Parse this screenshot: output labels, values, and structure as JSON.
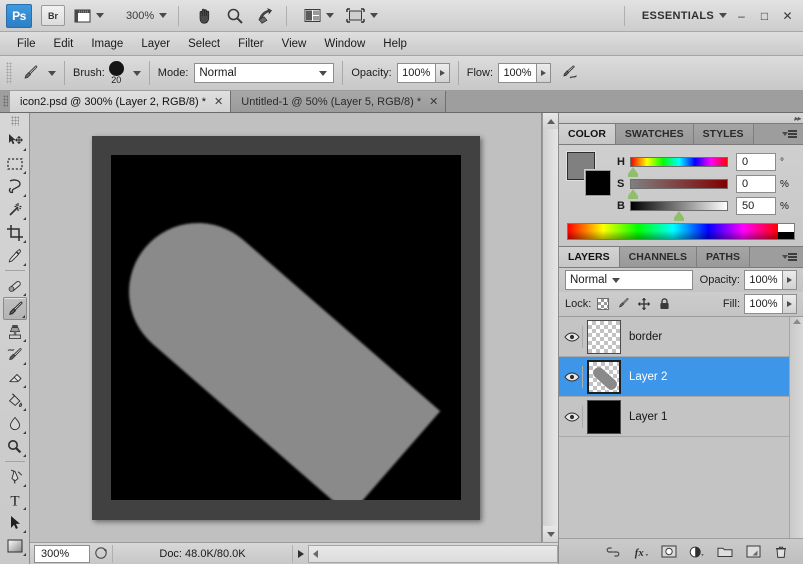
{
  "appbar": {
    "logo": "Ps",
    "bridge_label": "Br",
    "view_extras_icon": "view-extras-icon",
    "zoom_level": "300%",
    "hand_icon": "hand-tool-icon",
    "zoom_icon": "zoom-tool-icon",
    "rotate_icon": "rotate-view-icon",
    "arrange_icon": "arrange-documents-icon",
    "screen_mode_icon": "screen-mode-icon",
    "workspace": "ESSENTIALS",
    "minimize": "–",
    "maximize": "□",
    "close": "✕"
  },
  "menubar": {
    "items": [
      {
        "label": "File"
      },
      {
        "label": "Edit"
      },
      {
        "label": "Image"
      },
      {
        "label": "Layer"
      },
      {
        "label": "Select"
      },
      {
        "label": "Filter"
      },
      {
        "label": "View"
      },
      {
        "label": "Window"
      },
      {
        "label": "Help"
      }
    ]
  },
  "options_bar": {
    "tool_icon": "brush-tool-icon",
    "brush_label": "Brush:",
    "brush_size": "20",
    "mode_label": "Mode:",
    "mode_value": "Normal",
    "opacity_label": "Opacity:",
    "opacity_value": "100%",
    "flow_label": "Flow:",
    "flow_value": "100%",
    "airbrush_icon": "airbrush-icon"
  },
  "tabs": [
    {
      "title": "icon2.psd @ 300% (Layer 2, RGB/8) *",
      "close": "✕",
      "active": true
    },
    {
      "title": "Untitled-1 @ 50% (Layer 5, RGB/8) *",
      "close": "✕",
      "active": false
    }
  ],
  "toolbox": {
    "tools": [
      {
        "name": "move-tool",
        "active": false
      },
      {
        "name": "rectangular-marquee-tool",
        "active": false
      },
      {
        "name": "lasso-tool",
        "active": false
      },
      {
        "name": "magic-wand-tool",
        "active": false
      },
      {
        "name": "crop-tool",
        "active": false
      },
      {
        "name": "eyedropper-tool",
        "active": false
      },
      {
        "name": "healing-brush-tool",
        "active": false
      },
      {
        "name": "brush-tool",
        "active": true
      },
      {
        "name": "clone-stamp-tool",
        "active": false
      },
      {
        "name": "history-brush-tool",
        "active": false
      },
      {
        "name": "eraser-tool",
        "active": false
      },
      {
        "name": "paint-bucket-tool",
        "active": false
      },
      {
        "name": "blur-tool",
        "active": false
      },
      {
        "name": "dodge-tool",
        "active": false
      },
      {
        "name": "pen-tool",
        "active": false
      },
      {
        "name": "type-tool",
        "active": false
      },
      {
        "name": "path-selection-tool",
        "active": false
      },
      {
        "name": "shape-tool",
        "active": false
      }
    ]
  },
  "canvas": {
    "document_background": "#000000",
    "stroke_color": "#8a8a8a",
    "border_color": "#414141"
  },
  "status_bar": {
    "zoom": "300%",
    "doc_info": "Doc: 48.0K/80.0K"
  },
  "color_panel": {
    "tabs": [
      {
        "label": "COLOR",
        "active": true
      },
      {
        "label": "SWATCHES",
        "active": false
      },
      {
        "label": "STYLES",
        "active": false
      }
    ],
    "foreground_color": "#808080",
    "background_color": "#000000",
    "sliders": [
      {
        "name": "H",
        "value": "0",
        "unit": "°",
        "pos": 2
      },
      {
        "name": "S",
        "value": "0",
        "unit": "%",
        "pos": 2
      },
      {
        "name": "B",
        "value": "50",
        "unit": "%",
        "pos": 50
      }
    ]
  },
  "layers_panel": {
    "tabs": [
      {
        "label": "LAYERS",
        "active": true
      },
      {
        "label": "CHANNELS",
        "active": false
      },
      {
        "label": "PATHS",
        "active": false
      }
    ],
    "blend_mode": "Normal",
    "opacity_label": "Opacity:",
    "opacity_value": "100%",
    "lock_label": "Lock:",
    "fill_label": "Fill:",
    "fill_value": "100%",
    "lock_icons": [
      "lock-transparency-icon",
      "lock-image-icon",
      "lock-position-icon",
      "lock-all-icon"
    ],
    "layers": [
      {
        "name": "border",
        "visible": true,
        "selected": false,
        "thumb": "transparent"
      },
      {
        "name": "Layer 2",
        "visible": true,
        "selected": true,
        "thumb": "stroke"
      },
      {
        "name": "Layer 1",
        "visible": true,
        "selected": false,
        "thumb": "black"
      }
    ],
    "footer_icons": [
      "link-layers-icon",
      "layer-styles-icon",
      "layer-mask-icon",
      "adjustment-layer-icon",
      "new-group-icon",
      "new-layer-icon",
      "delete-layer-icon"
    ]
  }
}
